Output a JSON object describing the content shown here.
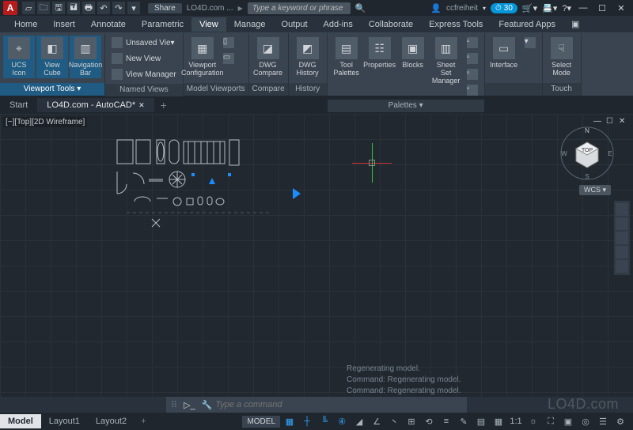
{
  "app": {
    "logo": "A",
    "share_label": "Share",
    "title": "LO4D.com ...",
    "search_placeholder": "Type a keyword or phrase"
  },
  "user": {
    "name": "ccfreiheit",
    "credits": "30"
  },
  "qat_icons": [
    "new",
    "open",
    "save",
    "saveall",
    "plot",
    "undo",
    "redo",
    "drop"
  ],
  "win_controls": {
    "min": "—",
    "max": "☐",
    "close": "✕"
  },
  "menu": {
    "tabs": [
      "Home",
      "Insert",
      "Annotate",
      "Parametric",
      "View",
      "Manage",
      "Output",
      "Add-ins",
      "Collaborate",
      "Express Tools",
      "Featured Apps"
    ],
    "active": 4,
    "overflow": "▣"
  },
  "ribbon": {
    "panels": [
      {
        "label": "Viewport Tools ▾",
        "selected": true,
        "big": [
          {
            "label": "UCS Icon",
            "icon": "⌖",
            "sel": true
          },
          {
            "label": "View Cube",
            "icon": "◧",
            "sel": true
          },
          {
            "label": "Navigation Bar",
            "icon": "▥",
            "sel": true
          }
        ]
      },
      {
        "label": "Named Views",
        "small": [
          {
            "label": "Unsaved Vie▾",
            "icon": "▤"
          },
          {
            "label": "New View",
            "icon": "✚"
          },
          {
            "label": "View Manager",
            "icon": "☰"
          }
        ]
      },
      {
        "label": "Model Viewports",
        "big": [
          {
            "label": "Viewport Configuration",
            "icon": "▦"
          }
        ],
        "extra": [
          "▯",
          "▭"
        ]
      },
      {
        "label": "Compare",
        "big": [
          {
            "label": "DWG Compare",
            "icon": "◪"
          }
        ]
      },
      {
        "label": "History",
        "big": [
          {
            "label": "DWG History",
            "icon": "◩"
          }
        ]
      },
      {
        "label": "Palettes ▾",
        "big": [
          {
            "label": "Tool Palettes",
            "icon": "▤"
          },
          {
            "label": "Properties",
            "icon": "☷"
          },
          {
            "label": "Blocks",
            "icon": "▣"
          },
          {
            "label": "Sheet Set Manager",
            "icon": "▥"
          }
        ],
        "extra": [
          "▫",
          "▫",
          "▫",
          "▫"
        ]
      },
      {
        "label": "",
        "big": [
          {
            "label": "Interface",
            "icon": "▭"
          }
        ],
        "extra": [
          "▾"
        ]
      },
      {
        "label": "Touch",
        "big": [
          {
            "label": "Select Mode",
            "icon": "☟"
          }
        ]
      }
    ]
  },
  "doctabs": {
    "tabs": [
      "Start",
      "LO4D.com - AutoCAD*"
    ],
    "active": 1
  },
  "viewport": {
    "label": "[−][Top][2D Wireframe]",
    "wcs": "WCS ▾",
    "compass": {
      "n": "N",
      "e": "E",
      "s": "S",
      "w": "W",
      "top": "TOP"
    }
  },
  "cmdlog": [
    "Regenerating model.",
    "Command:  Regenerating model.",
    "Command:  Regenerating model."
  ],
  "cmdline": {
    "prompt": "⨯",
    "placeholder": "Type a command"
  },
  "layouts": {
    "tabs": [
      "Model",
      "Layout1",
      "Layout2"
    ],
    "active": 0
  },
  "status": {
    "model": "MODEL",
    "icons": [
      "▦",
      "┼",
      "╚",
      "④",
      "◢",
      "∠",
      "丶",
      "⊞",
      "⟲",
      "≡",
      "✎",
      "▤",
      "▦",
      "1:1",
      "☼",
      "⛶",
      "▣",
      "◎",
      "☰",
      "⚙"
    ]
  },
  "watermark": "LO4D.com"
}
